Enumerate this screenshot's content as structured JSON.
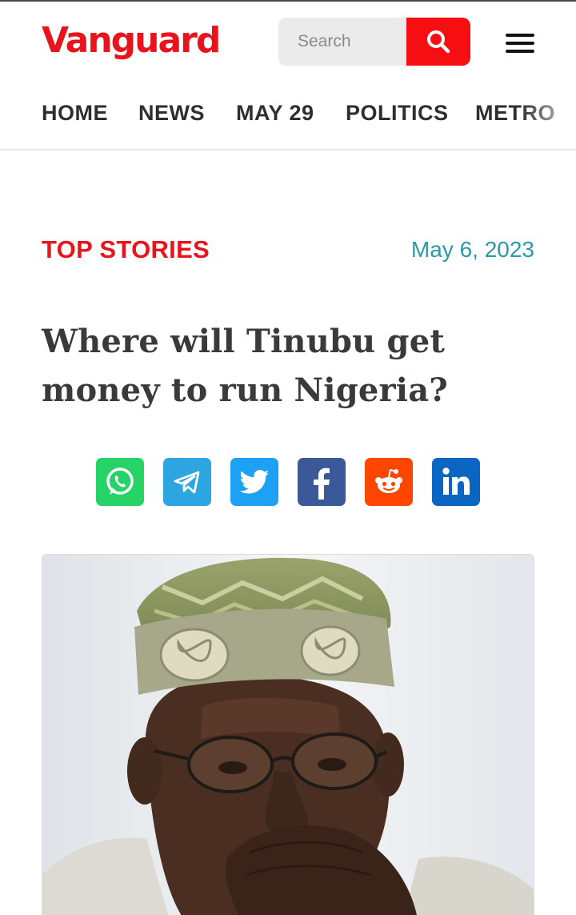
{
  "header": {
    "logo_text": "Vanguard",
    "search": {
      "placeholder": "Search",
      "value": ""
    }
  },
  "icons": {
    "search": "search-icon",
    "menu": "hamburger-menu-icon",
    "share": [
      "whatsapp-icon",
      "telegram-icon",
      "twitter-icon",
      "facebook-icon",
      "reddit-icon",
      "linkedin-icon"
    ]
  },
  "nav": {
    "items": [
      {
        "label": "HOME"
      },
      {
        "label": "NEWS"
      },
      {
        "label": "MAY 29"
      },
      {
        "label": "POLITICS"
      },
      {
        "label": "METRO"
      }
    ]
  },
  "article": {
    "category": "TOP STORIES",
    "date": "May 6, 2023",
    "headline": "Where will Tinubu get money to run Nigeria?"
  },
  "colors": {
    "brand_red": "#e8131c",
    "search_red": "#f50f13",
    "date_teal": "#2a9aa8",
    "whatsapp": "#25d366",
    "telegram": "#2ca5e0",
    "twitter": "#1da1f2",
    "facebook": "#3b5998",
    "reddit": "#ff4500",
    "linkedin": "#0a66c2"
  }
}
